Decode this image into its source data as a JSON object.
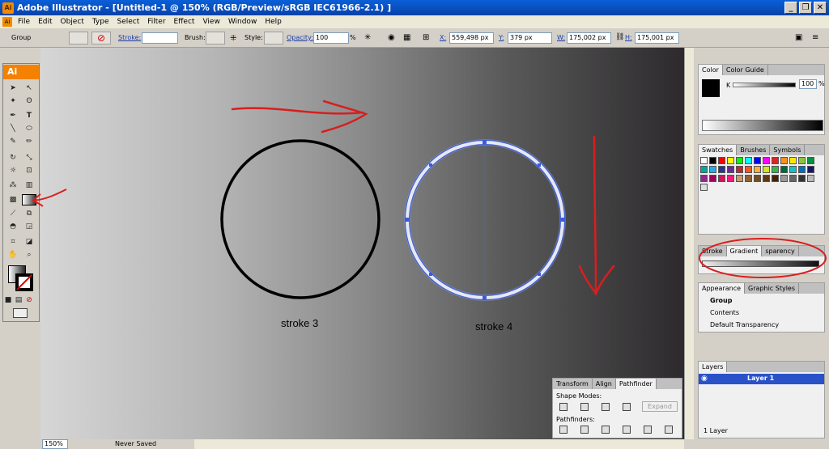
{
  "window": {
    "title": "Adobe Illustrator - [Untitled-1 @ 150% (RGB/Preview/sRGB IEC61966-2.1) ]",
    "app_icon": "Ai"
  },
  "menu": [
    "File",
    "Edit",
    "Object",
    "Type",
    "Select",
    "Filter",
    "Effect",
    "View",
    "Window",
    "Help"
  ],
  "control": {
    "selection": "Group",
    "stroke_label": "Stroke:",
    "brush_label": "Brush:",
    "style_label": "Style:",
    "opacity_label": "Opacity:",
    "opacity": "100",
    "opacity_unit": "%",
    "x_label": "X:",
    "x": "559,498 px",
    "y_label": "Y:",
    "y": "379 px",
    "w_label": "W:",
    "w": "175,002 px",
    "h_label": "H:",
    "h": "175,001 px"
  },
  "toolbox": {
    "badge": "Ai"
  },
  "canvas": {
    "caption_left": "stroke 3",
    "caption_right": "stroke 4",
    "colors": {
      "annotation": "#d81e1e",
      "selection": "#3a5cd8"
    }
  },
  "status": {
    "zoom": "150%",
    "state": "Never Saved"
  },
  "panels": {
    "color": {
      "tabs": [
        "Color",
        "Color Guide"
      ],
      "channel": "K",
      "value": "100",
      "unit": "%"
    },
    "swatches": {
      "tabs": [
        "Swatches",
        "Brushes",
        "Symbols"
      ]
    },
    "gradient": {
      "tabs": [
        "Stroke",
        "Gradient",
        "Transparency"
      ],
      "tab_visible": [
        "Stroke",
        "Gradient",
        "sparency"
      ]
    },
    "appearance": {
      "tabs": [
        "Appearance",
        "Graphic Styles"
      ],
      "rows": [
        "Group",
        "Contents",
        "Default Transparency"
      ]
    },
    "layers": {
      "tabs": [
        "Layers"
      ],
      "layer_name": "Layer 1",
      "footer": "1 Layer"
    },
    "pathfinder": {
      "tabs": [
        "Transform",
        "Align",
        "Pathfinder"
      ],
      "shape_modes": "Shape Modes:",
      "expand": "Expand",
      "pathfinders": "Pathfinders:"
    }
  }
}
